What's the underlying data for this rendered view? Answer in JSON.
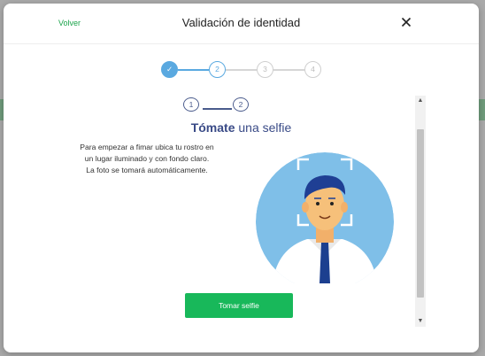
{
  "background": {
    "corner_color": "#1aa34a"
  },
  "modal": {
    "back_label": "Volver",
    "title": "Validación de identidad",
    "close_icon": "close-icon"
  },
  "stepper": {
    "steps": [
      {
        "label": "✓",
        "state": "done"
      },
      {
        "label": "2",
        "state": "active"
      },
      {
        "label": "3",
        "state": "todo"
      },
      {
        "label": "4",
        "state": "todo"
      }
    ]
  },
  "content": {
    "sub_steps": [
      "1",
      "2"
    ],
    "title_bold": "Tómate",
    "title_rest": " una selfie",
    "instructions": [
      "Para empezar a fimar ubica tu rostro en",
      "un lugar iluminado y con fondo claro.",
      "La foto se tomará automáticamente."
    ],
    "button_label": "Tomar selfie"
  },
  "scrollbar": {
    "up_icon": "▲",
    "down_icon": "▼"
  },
  "colors": {
    "accent_green": "#18b85a",
    "step_blue": "#5aa9e0",
    "title_navy": "#3a4b87",
    "illustration_bg": "#7fbfe8"
  }
}
